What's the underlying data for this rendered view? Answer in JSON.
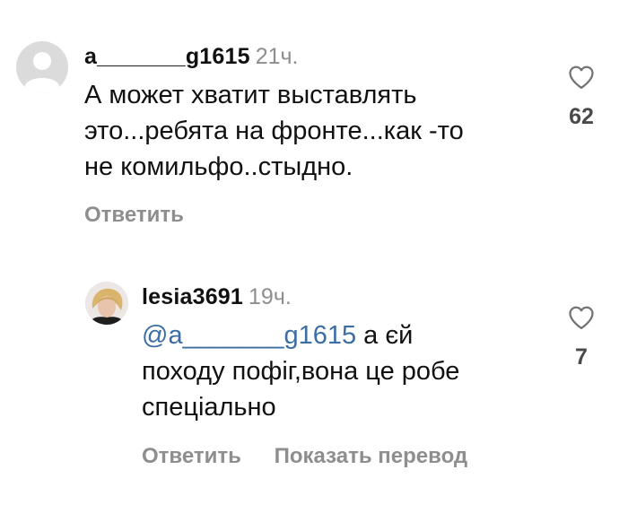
{
  "comments": [
    {
      "username": "a_______g1615",
      "time": "21ч.",
      "mention": "",
      "text_lines": [
        "А может хватит выставлять",
        "это...ребята на фронте...как -то",
        "не комильфо..стыдно."
      ],
      "likes": "62",
      "reply_label": "Ответить",
      "translate_label": ""
    },
    {
      "username": "lesia3691",
      "time": "19ч.",
      "mention": "@a_______g1615",
      "text_lines": [
        " а єй",
        "походу пофіг,вона це робе",
        "спеціально"
      ],
      "likes": "7",
      "reply_label": "Ответить",
      "translate_label": "Показать перевод"
    }
  ],
  "icons": {
    "avatar_default": "default-user-avatar",
    "avatar_photo": "user-photo-avatar",
    "like": "heart-outline-icon"
  },
  "colors": {
    "mention": "#3a6ea5",
    "meta_gray": "#8e8e8e"
  }
}
